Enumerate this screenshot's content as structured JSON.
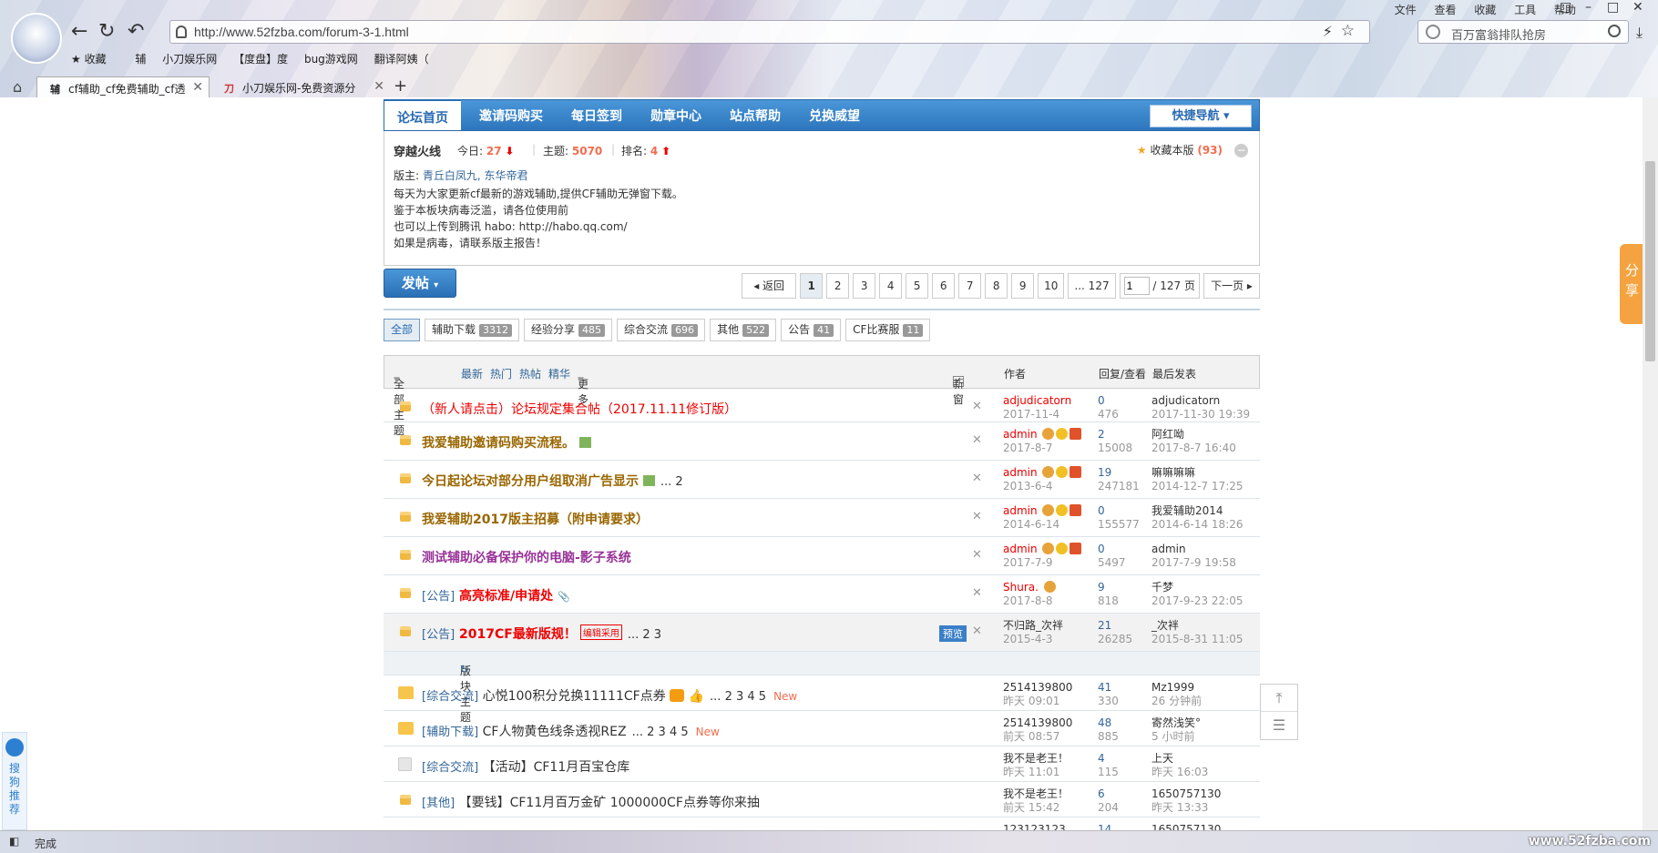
{
  "browser": {
    "url": "http://www.52fzba.com/forum-3-1.html",
    "search_placeholder": "百万富翁排队抢房",
    "menu": [
      "文件",
      "查看",
      "收藏",
      "工具",
      "帮助"
    ],
    "bookmarks": [
      "收藏",
      "辅",
      "小刀娱乐网",
      "【度盘】度",
      "bug游戏网",
      "翻译阿姨（"
    ],
    "tabs": [
      {
        "label": "cf辅助_cf免费辅助_cf透",
        "active": true
      },
      {
        "label": "小刀娱乐网-免费资源分",
        "active": false
      }
    ],
    "status": "完成",
    "watermark": "www.52fzba.com"
  },
  "nav": {
    "items": [
      "论坛首页",
      "邀请码购买",
      "每日签到",
      "勋章中心",
      "站点帮助",
      "兑换威望"
    ],
    "quick_nav": "快捷导航"
  },
  "forum": {
    "name": "穿越火线",
    "today_label": "今日:",
    "today": "27",
    "topics_label": "主题:",
    "topics": "5070",
    "rank_label": "排名:",
    "rank": "4",
    "mods_label": "版主:",
    "mods": "青丘白凤九, 东华帝君",
    "desc": [
      "每天为大家更新cf最新的游戏辅助,提供CF辅助无弹窗下载。",
      "鉴于本板块病毒泛滥，请各位使用前",
      "也可以上传到腾讯 habo:     http://habo.qq.com/",
      "如果是病毒，请联系版主报告！"
    ],
    "fav_label": "收藏本版",
    "fav_count": "(93)"
  },
  "post_button": "发帖",
  "pager": {
    "back": "返回",
    "pages": [
      "1",
      "2",
      "3",
      "4",
      "5",
      "6",
      "7",
      "8",
      "9",
      "10",
      "... 127"
    ],
    "input": "1",
    "total": "/ 127 页",
    "next": "下一页"
  },
  "filters": [
    {
      "label": "全部",
      "count": ""
    },
    {
      "label": "辅助下载",
      "count": "3312"
    },
    {
      "label": "经验分享",
      "count": "485"
    },
    {
      "label": "综合交流",
      "count": "696"
    },
    {
      "label": "其他",
      "count": "522"
    },
    {
      "label": "公告",
      "count": "41"
    },
    {
      "label": "CF比赛服",
      "count": "11"
    }
  ],
  "thead": {
    "all": "全部主题",
    "latest": "最新",
    "hot": "热门",
    "hotpost": "热帖",
    "digest": "精华",
    "more": "更多",
    "newwin": "新窗",
    "author": "作者",
    "replies": "回复/查看",
    "last": "最后发表"
  },
  "sticky": [
    {
      "subject": "（新人请点击）论坛规定集合帖（2017.11.11修订版）",
      "author": "adjudicatorn",
      "date": "2017-11-4",
      "replies": "0",
      "views": "476",
      "last_user": "adjudicatorn",
      "last_date": "2017-11-30 19:39"
    },
    {
      "subject": "我爱辅助邀请码购买流程。",
      "author": "admin",
      "date": "2017-8-7",
      "replies": "2",
      "views": "15008",
      "last_user": "阿红呦",
      "last_date": "2017-8-7 16:40"
    },
    {
      "subject": "今日起论坛对部分用户组取消广告显示",
      "pages": "... 2",
      "author": "admin",
      "date": "2013-6-4",
      "replies": "19",
      "views": "247181",
      "last_user": "嘛嘛嘛嘛",
      "last_date": "2014-12-7 17:25"
    },
    {
      "subject": "我爱辅助2017版主招募（附申请要求）",
      "author": "admin",
      "date": "2014-6-14",
      "replies": "0",
      "views": "155577",
      "last_user": "我爱辅助2014",
      "last_date": "2014-6-14 18:26"
    },
    {
      "subject": "测试辅助必备保护你的电脑-影子系统",
      "author": "admin",
      "date": "2017-7-9",
      "replies": "0",
      "views": "5497",
      "last_user": "admin",
      "last_date": "2017-7-9 19:58"
    },
    {
      "category": "[公告]",
      "subject": "高亮标准/申请处",
      "author": "Shura.",
      "date": "2017-8-8",
      "replies": "9",
      "views": "818",
      "last_user": "千梦",
      "last_date": "2017-9-23 22:05"
    },
    {
      "category": "[公告]",
      "subject": "2017CF最新版规！",
      "badge": "编辑采用",
      "pages": "... 2  3",
      "preview": "预览",
      "author": "不归路_次袢",
      "date": "2015-4-3",
      "replies": "21",
      "views": "26285",
      "last_user": "_次袢",
      "last_date": "2015-8-31 11:05"
    }
  ],
  "section_header": "版块主题",
  "threads": [
    {
      "category": "[综合交流]",
      "subject": "心悦100积分兑换11111CF点券",
      "pages": "... 2  3  4  5",
      "new": "New",
      "author": "2514139800",
      "date": "昨天 09:01",
      "replies": "41",
      "views": "330",
      "last_user": "Mz1999",
      "last_date": "26 分钟前"
    },
    {
      "category": "[辅助下载]",
      "subject": "CF人物黄色线条透视REZ",
      "pages": "... 2  3  4  5",
      "new": "New",
      "author": "2514139800",
      "date": "前天 08:57",
      "replies": "48",
      "views": "885",
      "last_user": "寄然浅笑°",
      "last_date": "5 小时前"
    },
    {
      "category": "[综合交流]",
      "subject": "【活动】CF11月百宝仓库",
      "pages": "",
      "new": "",
      "author": "我不是老王！",
      "date": "昨天 11:01",
      "replies": "4",
      "views": "115",
      "last_user": "上天",
      "last_date": "昨天 16:03"
    },
    {
      "category": "[其他]",
      "subject": "【要钱】CF11月百万金矿 1000000CF点券等你来抽",
      "pages": "",
      "new": "",
      "author": "我不是老王！",
      "date": "前天 15:42",
      "replies": "6",
      "views": "204",
      "last_user": "1650757130",
      "last_date": "昨天 13:33"
    },
    {
      "category": "",
      "subject": "",
      "pages": "",
      "new": "",
      "author": "123123123",
      "date": "",
      "replies": "14",
      "views": "",
      "last_user": "1650757130",
      "last_date": ""
    }
  ],
  "share": "分享",
  "sogou": "搜狗推荐"
}
